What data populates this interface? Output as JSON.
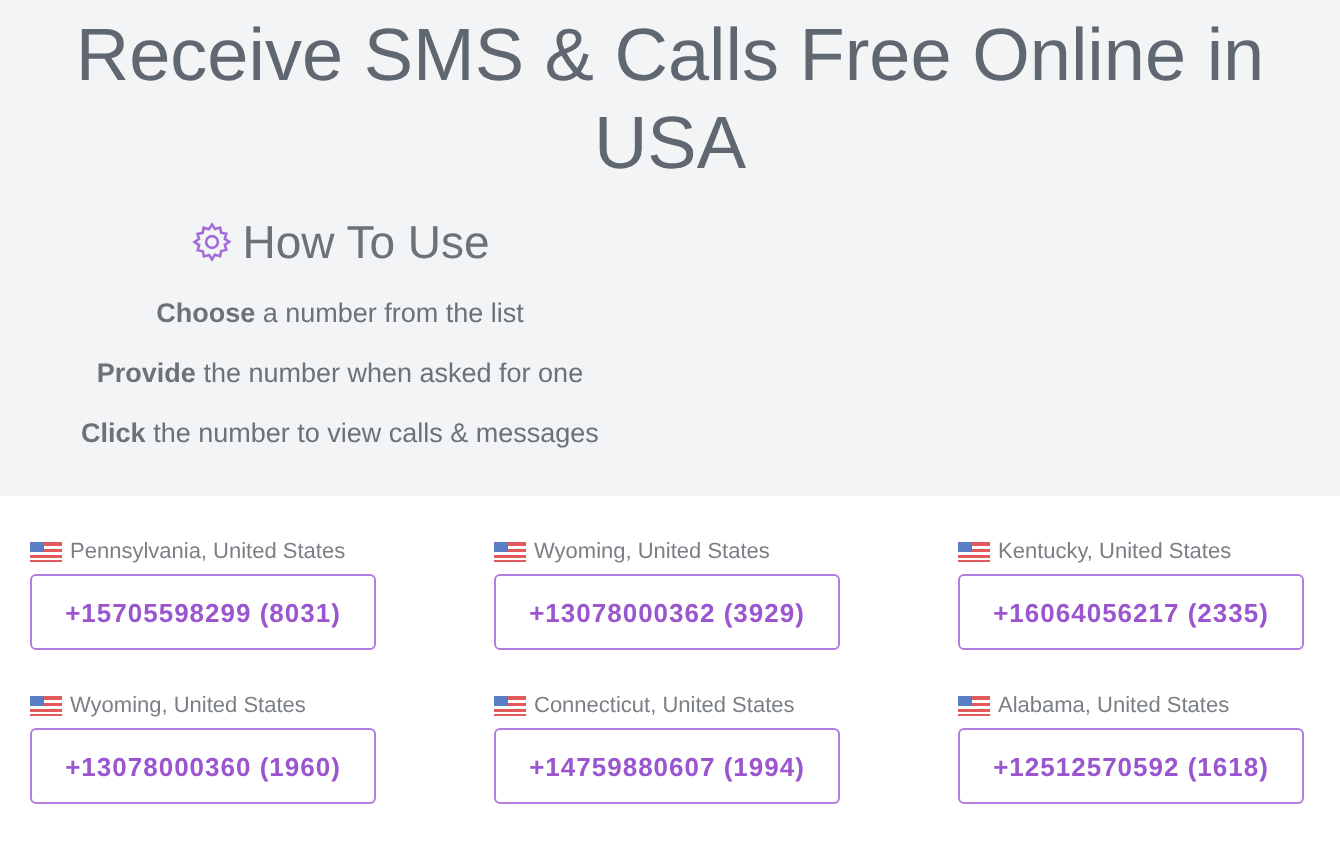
{
  "heading": {
    "line_1": "Receive SMS & Calls Free Online in",
    "line_2": "USA"
  },
  "how_to_use": {
    "title": "How To Use",
    "steps": [
      "**Choose** a number from the list",
      "**Provide** the number when asked for one",
      "**Click** the number to view calls & messages"
    ]
  },
  "numbers": [
    {
      "location": "Pennsylvania, United States",
      "number": "+15705598299 (8031)"
    },
    {
      "location": "Wyoming, United States",
      "number": "+13078000362 (3929)"
    },
    {
      "location": "Kentucky, United States",
      "number": "+16064056217 (2335)"
    },
    {
      "location": "Wyoming, United States",
      "number": "+13078000360 (1960)"
    },
    {
      "location": "Connecticut, United States",
      "number": "+14759880607 (1994)"
    },
    {
      "location": "Alabama, United States",
      "number": "+12512570592 (1618)"
    }
  ]
}
